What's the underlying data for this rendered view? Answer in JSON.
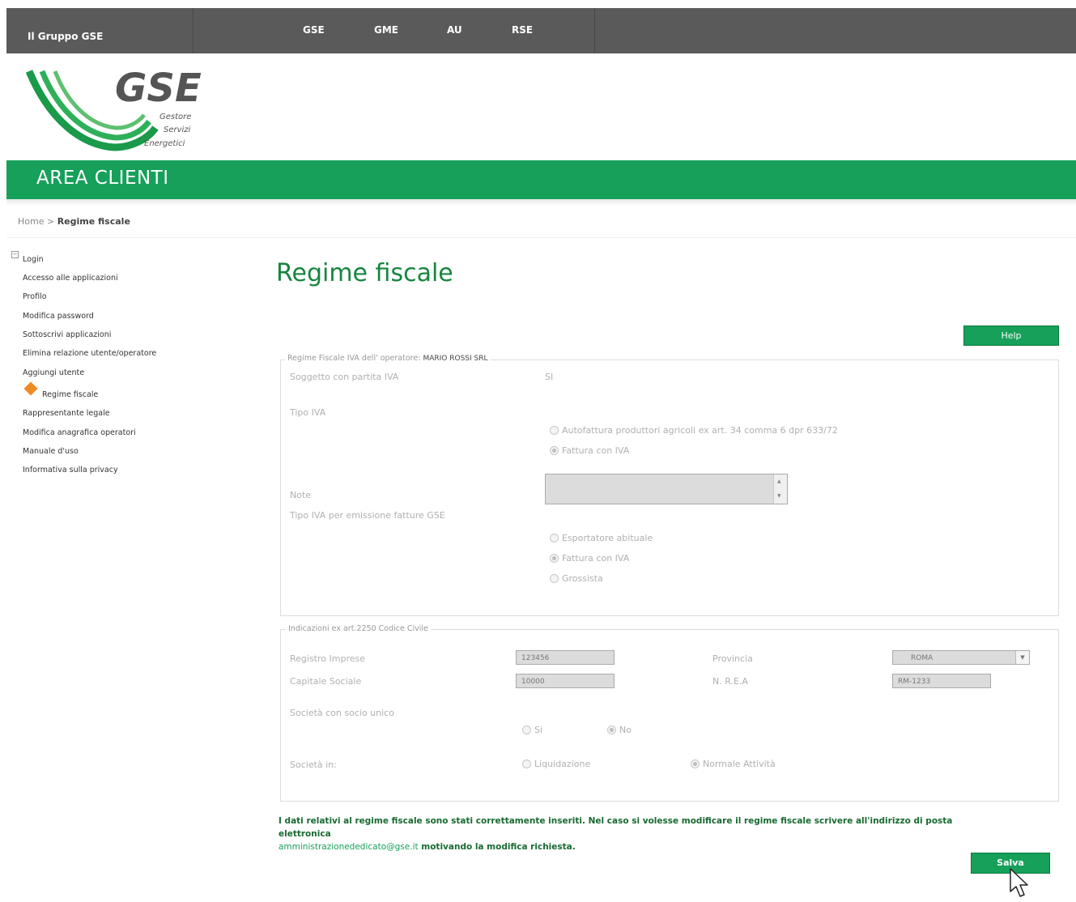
{
  "topbar": {
    "group": "Il Gruppo GSE",
    "nav": [
      "GSE",
      "GME",
      "AU",
      "RSE"
    ]
  },
  "logo": {
    "brand": "GSE",
    "tagline": [
      "Gestore",
      "Servizi",
      "Energetici"
    ]
  },
  "banner": "AREA CLIENTI",
  "breadcrumb": {
    "home": "Home",
    "sep": ">",
    "current": "Regime fiscale"
  },
  "sidebar": {
    "section": "Login",
    "items": [
      "Accesso alle applicazioni",
      "Profilo",
      "Modifica password",
      "Sottoscrivi applicazioni",
      "Elimina relazione utente/operatore",
      "Aggiungi utente",
      "Regime fiscale",
      "Rappresentante legale",
      "Modifica anagrafica operatori",
      "Manuale d'uso",
      "Informativa sulla privacy"
    ],
    "active_index": 6
  },
  "page_title": "Regime fiscale",
  "help_label": "Help",
  "fiscal": {
    "legend": "Regime Fiscale IVA dell' operatore:",
    "operator": "MARIO ROSSI SRL",
    "soggetto_label": "Soggetto con partita IVA",
    "soggetto_value": "SI",
    "tipo_iva_label": "Tipo IVA",
    "tipo_iva_options": [
      {
        "label": "Autofattura produttori agricoli ex art. 34 comma 6 dpr 633/72",
        "checked": false
      },
      {
        "label": "Fattura con IVA",
        "checked": true
      }
    ],
    "note_label": "Note",
    "tipo_iva_gse_label": "Tipo IVA per emissione fatture GSE",
    "tipo_iva_gse_options": [
      {
        "label": "Esportatore abituale",
        "checked": false
      },
      {
        "label": "Fattura con IVA",
        "checked": true
      },
      {
        "label": "Grossista",
        "checked": false
      }
    ]
  },
  "civile": {
    "legend": "Indicazioni ex art.2250 Codice Civile",
    "registro_label": "Registro Imprese",
    "registro_value": "123456",
    "provincia_label": "Provincia",
    "provincia_value": "ROMA",
    "capitale_label": "Capitale Sociale",
    "capitale_value": "10000",
    "rea_label": "N. R.E.A",
    "rea_value": "RM-1233",
    "socio_label": "Società con socio unico",
    "socio_options": [
      {
        "label": "Si",
        "checked": false
      },
      {
        "label": "No",
        "checked": true
      }
    ],
    "stato_label": "Società in:",
    "stato_options": [
      {
        "label": "Liquidazione",
        "checked": false
      },
      {
        "label": "Normale Attività",
        "checked": true
      }
    ]
  },
  "message": {
    "part1": "I dati relativi al regime fiscale sono stati correttamente inseriti. Nel caso si volesse modificare il regime fiscale scrivere all'indirizzo di posta elettronica",
    "email": "amministrazionededicato@gse.it",
    "part2": "motivando la modifica richiesta."
  },
  "save_label": "Salva",
  "colors": {
    "brand_green": "#16a05a",
    "topbar": "#5a5a5a",
    "title_green": "#16853e",
    "accent_orange": "#f08a24"
  }
}
